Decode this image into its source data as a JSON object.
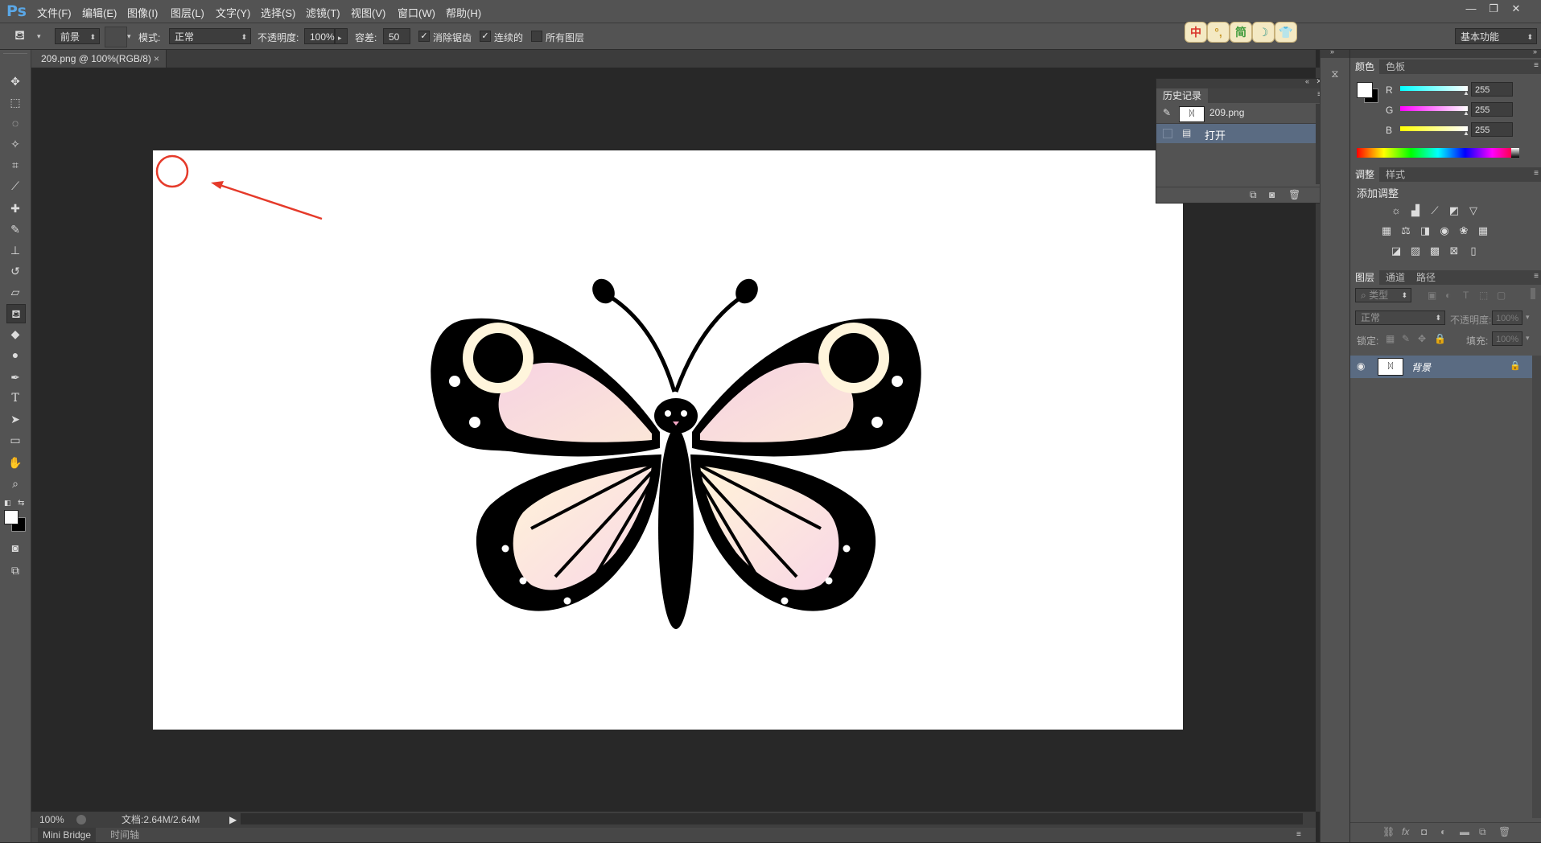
{
  "app": {
    "logo": "Ps"
  },
  "menu": [
    "文件(F)",
    "编辑(E)",
    "图像(I)",
    "图层(L)",
    "文字(Y)",
    "选择(S)",
    "滤镜(T)",
    "视图(V)",
    "窗口(W)",
    "帮助(H)"
  ],
  "window_controls": {
    "minimize": "—",
    "restore": "❐",
    "close": "✕"
  },
  "options": {
    "fill_source": "前景",
    "mode_label": "模式:",
    "mode_value": "正常",
    "opacity_label": "不透明度:",
    "opacity_value": "100%",
    "tolerance_label": "容差:",
    "tolerance_value": "50",
    "anti_alias": "消除锯齿",
    "contiguous": "连续的",
    "all_layers": "所有图层",
    "workspace": "基本功能",
    "ime_buttons": [
      "中",
      "°,",
      "简",
      "☽",
      "👕"
    ]
  },
  "document": {
    "tab_title": "209.png @ 100%(RGB/8)",
    "tab_close": "×",
    "zoom": "100%",
    "doc_info": "文档:2.64M/2.64M"
  },
  "bottom_tabs": [
    "Mini Bridge",
    "时间轴"
  ],
  "history": {
    "title": "历史记录",
    "snapshot": "209.png",
    "steps": [
      "打开"
    ]
  },
  "color_panel": {
    "tabs": [
      "颜色",
      "色板"
    ],
    "channels": [
      {
        "name": "R",
        "value": "255"
      },
      {
        "name": "G",
        "value": "255"
      },
      {
        "name": "B",
        "value": "255"
      }
    ]
  },
  "adjust_panel": {
    "tabs": [
      "调整",
      "样式"
    ],
    "title": "添加调整"
  },
  "layers_panel": {
    "tabs": [
      "图层",
      "通道",
      "路径"
    ],
    "filter_kind": "类型",
    "blend_mode": "正常",
    "opacity_label": "不透明度:",
    "opacity_value": "100%",
    "lock_label": "锁定:",
    "fill_label": "填充:",
    "fill_value": "100%",
    "layer_name": "背景"
  },
  "colors": {
    "accent_blue": "#5aa7e6",
    "selection_blue": "#5a6b82",
    "annotation_red": "#e53a2a"
  }
}
